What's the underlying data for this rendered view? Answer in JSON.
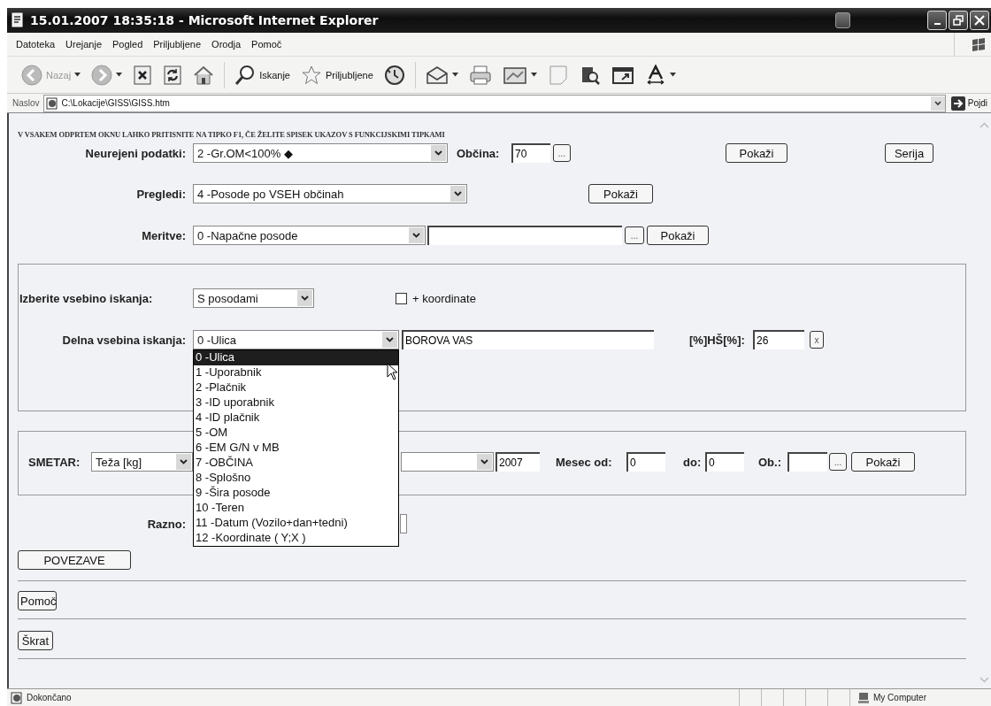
{
  "window": {
    "title": "15.01.2007 18:35:18 - Microsoft Internet Explorer"
  },
  "menu": [
    "Datoteka",
    "Urejanje",
    "Pogled",
    "Priljubljene",
    "Orodja",
    "Pomoč"
  ],
  "toolbar": [
    {
      "kind": "back",
      "label": "Nazaj"
    },
    {
      "kind": "forward"
    },
    {
      "kind": "stop"
    },
    {
      "kind": "refresh"
    },
    {
      "kind": "home"
    },
    {
      "kind": "search",
      "label": "Iskanje"
    },
    {
      "kind": "favorites",
      "label": "Priljubljene"
    },
    {
      "kind": "history"
    },
    {
      "kind": "mail"
    },
    {
      "kind": "print"
    },
    {
      "kind": "edit"
    },
    {
      "kind": "note"
    },
    {
      "kind": "research"
    },
    {
      "kind": "window"
    },
    {
      "kind": "font"
    }
  ],
  "address": {
    "label": "Naslov",
    "value": "C:\\Lokacije\\GISS\\GISS.htm",
    "go": "Pojdi"
  },
  "page": {
    "notice": "V VSAKEM ODPRTEM OKNU LAHKO PRITISNITE NA TIPKO F1, ČE ŽELITE SPISEK UKAZOV S FUNKCIJSKIMI TIPKAMI",
    "rows": [
      {
        "items": [
          {
            "kind": "label",
            "text": "Neurejeni podatki:"
          },
          {
            "kind": "select",
            "value": "2 -Gr.OM<100% ◆"
          },
          {
            "kind": "label",
            "text": "Občina:"
          },
          {
            "kind": "input",
            "value": "70"
          },
          {
            "kind": "small_button",
            "text": "..."
          },
          {
            "kind": "button",
            "text": "Pokaži"
          },
          {
            "kind": "button",
            "text": "Serija"
          }
        ]
      },
      {
        "items": [
          {
            "kind": "label",
            "text": "Pregledi:"
          },
          {
            "kind": "select",
            "value": "4 -Posode po VSEH občinah"
          },
          {
            "kind": "button",
            "text": "Pokaži"
          }
        ]
      },
      {
        "items": [
          {
            "kind": "label",
            "text": "Meritve:"
          },
          {
            "kind": "select",
            "value": "0 -Napačne posode"
          },
          {
            "kind": "input"
          },
          {
            "kind": "small_button",
            "text": "..."
          },
          {
            "kind": "button",
            "text": "Pokaži"
          }
        ]
      }
    ],
    "panels": [
      {
        "rows": [
          {
            "items": [
              {
                "kind": "label",
                "text": "Izberite vsebino iskanja:"
              },
              {
                "kind": "select",
                "value": "S posodami"
              },
              {
                "kind": "checkbox",
                "text": "+ koordinate",
                "checked": false
              }
            ]
          },
          {
            "items": [
              {
                "kind": "label",
                "text": "Delna vsebina iskanja:"
              },
              {
                "kind": "select",
                "value": "0 -Ulica",
                "expanded": true,
                "options": [
                  {
                    "text": "0 -Ulica",
                    "selected": true
                  },
                  {
                    "text": "1 -Uporabnik",
                    "selected": false
                  },
                  {
                    "text": "2 -Plačnik",
                    "selected": false
                  },
                  {
                    "text": "3 -ID uporabnik",
                    "selected": false
                  },
                  {
                    "text": "4 -ID plačnik",
                    "selected": false
                  },
                  {
                    "text": "5 -OM",
                    "selected": false
                  },
                  {
                    "text": "6 -EM G/N v MB",
                    "selected": false
                  },
                  {
                    "text": "7 -OBČINA",
                    "selected": false
                  },
                  {
                    "text": "8 -Splošno",
                    "selected": false
                  },
                  {
                    "text": "9 -Šira posode",
                    "selected": false
                  },
                  {
                    "text": "10 -Teren",
                    "selected": false
                  },
                  {
                    "text": "11 -Datum (Vozilo+dan+tedni)",
                    "selected": false
                  },
                  {
                    "text": "12 -Koordinate ( Y;X )",
                    "selected": false
                  }
                ]
              },
              {
                "kind": "input",
                "value": "BOROVA VAS"
              },
              {
                "kind": "label",
                "text": "[%]HŠ[%]:"
              },
              {
                "kind": "input",
                "value": "26"
              },
              {
                "kind": "small_button",
                "text": "x"
              }
            ]
          }
        ]
      },
      {
        "rows": [
          {
            "items": [
              {
                "kind": "label",
                "text": "SMETAR:"
              },
              {
                "kind": "select",
                "value": "Teža [kg]"
              },
              {
                "kind": "select"
              },
              {
                "kind": "input",
                "value": "2007"
              },
              {
                "kind": "label",
                "text": "Mesec od:"
              },
              {
                "kind": "input",
                "value": "0"
              },
              {
                "kind": "label",
                "text": "do:"
              },
              {
                "kind": "input",
                "value": "0"
              },
              {
                "kind": "label",
                "text": "Ob.:"
              },
              {
                "kind": "input"
              },
              {
                "kind": "small_button",
                "text": "..."
              },
              {
                "kind": "button",
                "text": "Pokaži"
              }
            ]
          }
        ]
      }
    ],
    "rows_after": [
      {
        "items": [
          {
            "kind": "label",
            "text": "Razno:"
          },
          {
            "kind": "select"
          }
        ]
      }
    ],
    "buttons": [
      "POVEZAVE",
      "Pomoč",
      "Škrat"
    ]
  },
  "status_bar": {
    "text": "Dokončano",
    "zone": "My Computer"
  }
}
